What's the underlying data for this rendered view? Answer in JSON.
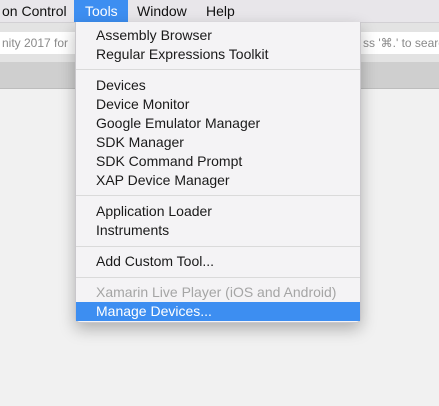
{
  "menubar": {
    "items": [
      {
        "label": "on Control"
      },
      {
        "label": "Tools"
      },
      {
        "label": "Window"
      },
      {
        "label": "Help"
      }
    ]
  },
  "search": {
    "left_text": "nity 2017 for",
    "right_text": "ss '⌘.' to searc"
  },
  "tools_menu": {
    "assembly_browser": "Assembly Browser",
    "regex_toolkit": "Regular Expressions Toolkit",
    "devices": "Devices",
    "device_monitor": "Device Monitor",
    "google_emulator_manager": "Google Emulator Manager",
    "sdk_manager": "SDK Manager",
    "sdk_command_prompt": "SDK Command Prompt",
    "xap_device_manager": "XAP Device Manager",
    "application_loader": "Application Loader",
    "instruments": "Instruments",
    "add_custom_tool": "Add Custom Tool...",
    "xamarin_live_player": "Xamarin Live Player (iOS and Android)",
    "manage_devices": "Manage Devices..."
  },
  "colors": {
    "highlight": "#3d8ef1",
    "disabled_text": "#a5a5a5"
  }
}
